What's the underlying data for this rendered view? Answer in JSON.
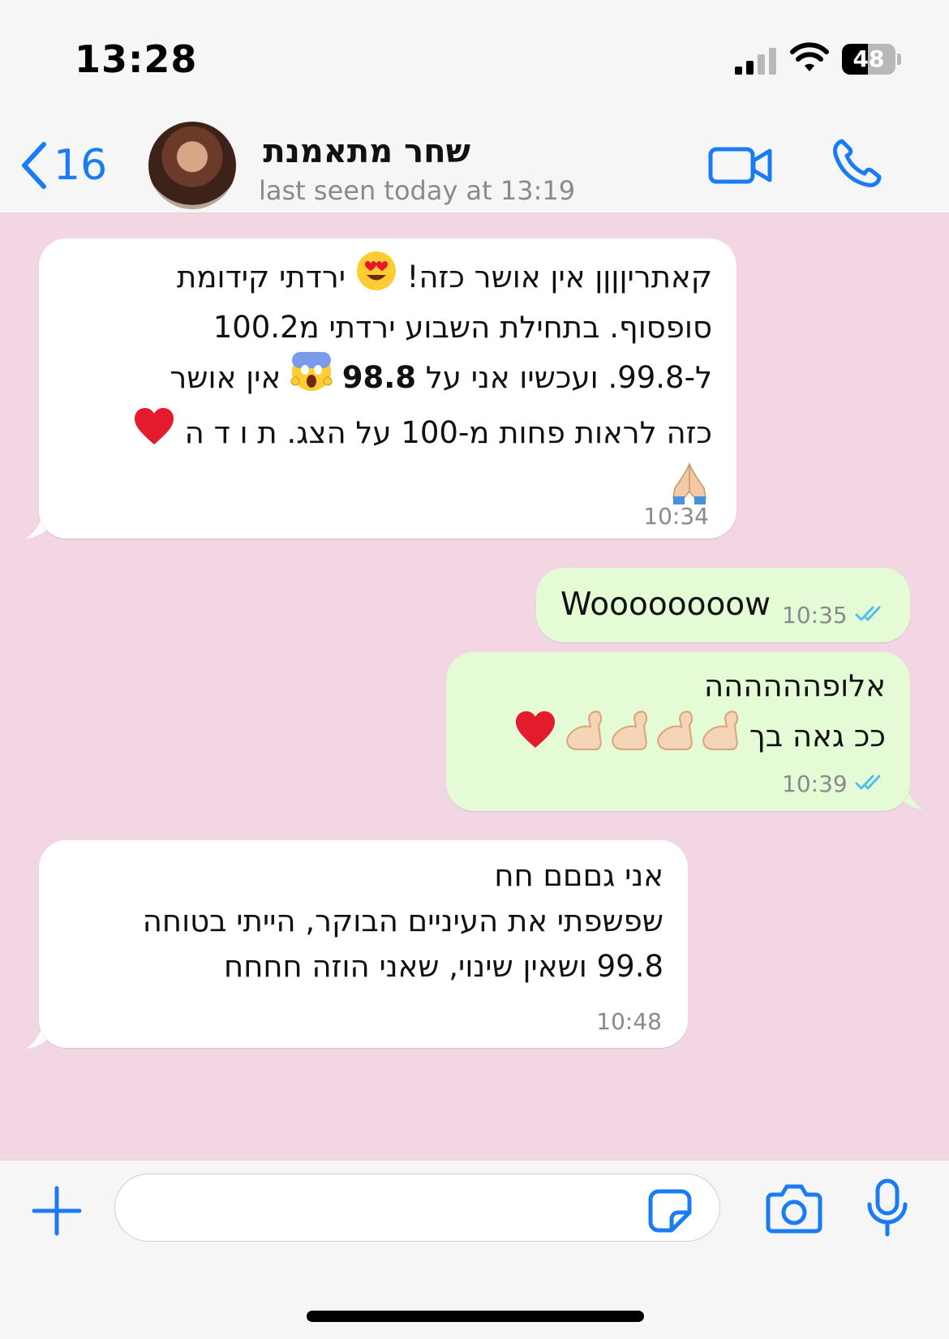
{
  "status_bar": {
    "time": "13:28",
    "battery_level": "48",
    "battery_fraction": 0.48
  },
  "header": {
    "back_count": "16",
    "contact_name": "שחר מתאמנת",
    "last_seen": "last seen today at 13:19"
  },
  "messages": [
    {
      "direction": "incoming",
      "time": "10:34",
      "line1_a": "קאתריןןןן אין אושר כזה! ",
      "line1_b": " ירדתי קידומת",
      "line2": "סופסוף. בתחילת השבוע ירדתי מ100.2",
      "line3_a": "ל-99.8. ועכשיו אני על ",
      "line3_bold": "98.8",
      "line3_b": " אין אושר",
      "line4": "כזה לראות פחות מ-100 על הצג. ת ו ד ה "
    },
    {
      "direction": "outgoing",
      "time": "10:35",
      "text": "Woooooooow"
    },
    {
      "direction": "outgoing",
      "time": "10:39",
      "line1": "אלופהההההה",
      "line2": "ככ גאה בך "
    },
    {
      "direction": "incoming",
      "time": "10:48",
      "line1": "אני גםםם חח",
      "line2": "שפשפתי את העיניים הבוקר, הייתי בטוחה",
      "line3": "99.8 ושאין שינוי, שאני הוזה חחחח"
    }
  ],
  "icons": {
    "back": "chevron-left-icon",
    "video": "video-camera-icon",
    "call": "phone-icon",
    "plus": "plus-icon",
    "sticker": "sticker-icon",
    "camera": "camera-icon",
    "mic": "microphone-icon",
    "read_receipt": "double-check-icon"
  },
  "colors": {
    "accent": "#1a7cf5",
    "chat_bg": "#f2d6e4",
    "outgoing_bubble": "#e5fbd6",
    "incoming_bubble": "#ffffff",
    "read_tick": "#53bdeb"
  }
}
